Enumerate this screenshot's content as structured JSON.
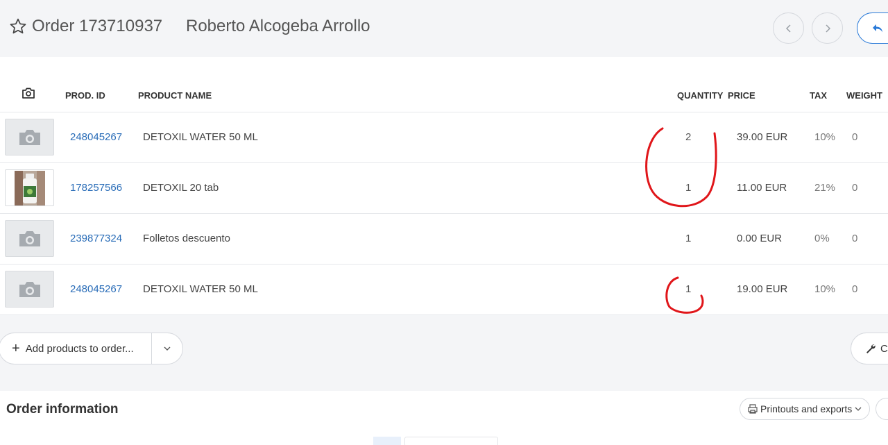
{
  "header": {
    "order_title": "Order 173710937",
    "customer_name": "Roberto Alcogeba Arrollo",
    "icons": {
      "favorite": "star-icon",
      "prev": "chevron-left-icon",
      "next": "chevron-right-icon",
      "back": "reply-icon"
    }
  },
  "table": {
    "columns": {
      "prod_id": "PROD. ID",
      "product_name": "PRODUCT NAME",
      "quantity": "QUANTITY",
      "price": "PRICE",
      "tax": "TAX",
      "weight": "WEIGHT"
    },
    "rows": [
      {
        "prod_id": "248045267",
        "name": "DETOXIL WATER 50 ML",
        "quantity": "2",
        "price": "39.00 EUR",
        "tax": "10%",
        "weight": "0",
        "thumb": "placeholder"
      },
      {
        "prod_id": "178257566",
        "name": "DETOXIL 20 tab",
        "quantity": "1",
        "price": "11.00 EUR",
        "tax": "21%",
        "weight": "0",
        "thumb": "photo"
      },
      {
        "prod_id": "239877324",
        "name": "Folletos descuento",
        "quantity": "1",
        "price": "0.00 EUR",
        "tax": "0%",
        "weight": "0",
        "thumb": "placeholder"
      },
      {
        "prod_id": "248045267",
        "name": "DETOXIL WATER 50 ML",
        "quantity": "1",
        "price": "19.00 EUR",
        "tax": "10%",
        "weight": "0",
        "thumb": "placeholder"
      }
    ]
  },
  "actions": {
    "add_products": "Add products to order...",
    "tools_fragment": "C"
  },
  "order_info": {
    "title": "Order information",
    "printouts": "Printouts and exports"
  },
  "colors": {
    "link": "#2a6db8",
    "accent": "#2a7ad8",
    "annotation": "#e0161a"
  }
}
